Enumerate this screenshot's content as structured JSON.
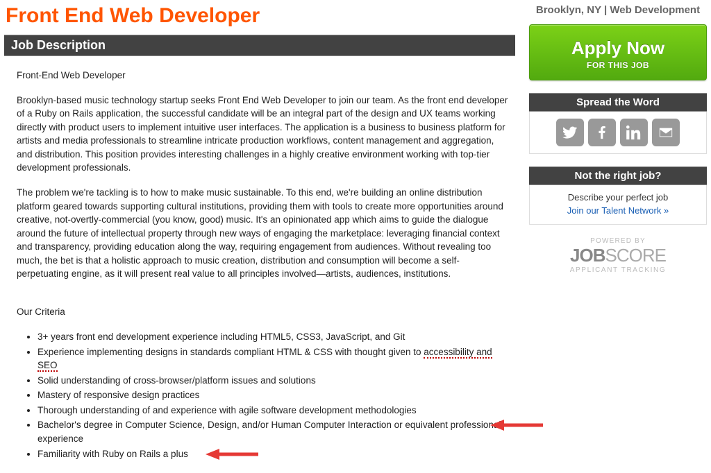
{
  "header": {
    "title": "Front End Web Developer",
    "location_meta": "Brooklyn, NY | Web Development"
  },
  "job": {
    "section_title": "Job Description",
    "subtitle": "Front-End Web Developer",
    "para1": "Brooklyn-based music technology startup seeks Front End Web Developer to join our team. As the front end developer of a Ruby on Rails application, the successful candidate will be an integral part of the design and UX teams working directly with product users to implement intuitive user interfaces. The application is a business to business platform for artists and media professionals to streamline intricate production workflows, content management and aggregation, and distribution.  This position provides interesting challenges in a highly creative environment working with top-tier development professionals.",
    "para2": "The problem we're tackling is to how to make music sustainable. To this end, we're building an online distribution platform geared towards supporting cultural institutions, providing them with tools to create more opportunities around creative, not-overtly-commercial (you know, good) music. It's an opinionated app which aims to guide the dialogue around the future of intellectual property through new ways of engaging the marketplace: leveraging financial context and transparency, providing education along the way, requiring engagement from audiences. Without revealing too much, the bet is that a holistic approach to music creation, distribution and consumption will become a self-perpetuating engine, as it will present real value to all principles involved—artists, audiences, institutions.",
    "criteria_label": "Our Criteria",
    "criteria": [
      "3+ years front end development experience including HTML5, CSS3, JavaScript, and Git",
      {
        "pre": "Experience implementing designs in standards compliant HTML & CSS with thought given to ",
        "acc": "accessibility and SEO"
      },
      "Solid understanding of cross-browser/platform issues and solutions",
      "Mastery of responsive design practices",
      "Thorough understanding of and experience with agile software development methodologies",
      "Bachelor's degree in Computer Science, Design, and/or Human Computer Interaction or equivalent professional experience",
      "Familiarity with Ruby on Rails a plus"
    ]
  },
  "sidebar": {
    "apply": {
      "main": "Apply Now",
      "sub": "FOR THIS JOB"
    },
    "spread": {
      "header": "Spread the Word",
      "icons": [
        "twitter",
        "facebook",
        "linkedin",
        "email"
      ]
    },
    "notright": {
      "header": "Not the right job?",
      "desc": "Describe your perfect job",
      "link": "Join our Talent Network »"
    },
    "powered": {
      "label": "POWERED BY",
      "brand_bold": "JOB",
      "brand_light": "SCORE",
      "tag": "APPLICANT TRACKING"
    }
  }
}
